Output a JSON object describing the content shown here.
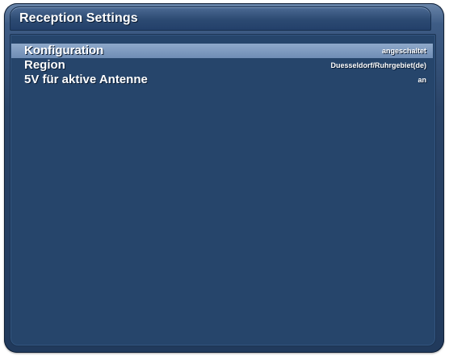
{
  "window": {
    "title": "Reception Settings"
  },
  "settings": {
    "items": [
      {
        "label": "Konfiguration",
        "value": "angeschaltet",
        "selected": true
      },
      {
        "label": "Region",
        "value": "Duesseldorf/Ruhrgebiet(de)",
        "selected": false
      },
      {
        "label": "5V für aktive Antenne",
        "value": "an",
        "selected": false
      }
    ]
  },
  "colors": {
    "background": "#26456b",
    "selection_highlight": "#7f9bc0",
    "text": "#ffffff"
  }
}
